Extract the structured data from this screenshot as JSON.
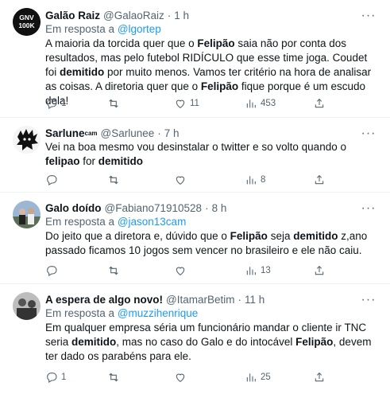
{
  "tweets": [
    {
      "name": "Galão Raiz",
      "handle": "@GalaoRaiz",
      "time": "1 h",
      "reply_prefix": "Em resposta a",
      "reply_to": "@lgortep",
      "body": [
        {
          "t": "A maioria da torcida quer que o "
        },
        {
          "t": "Felipão",
          "b": true
        },
        {
          "t": " saia não por conta dos resultados, mas pelo futebol RIDÍCULO que esse time joga. Coudet foi "
        },
        {
          "t": "demitido",
          "b": true
        },
        {
          "t": " por muito menos. Vamos ter critério na hora de analisar as coisas. A diretoria quer que o "
        },
        {
          "t": "Felipão",
          "b": true
        },
        {
          "t": " fique porque é um escudo dela!"
        }
      ],
      "replies": "1",
      "retweets": "",
      "likes": "11",
      "views": "453",
      "avatar": {
        "type": "gnv",
        "line1": "GNV",
        "line2": "100K"
      }
    },
    {
      "name": "Sarlune",
      "name_sup": "cam",
      "handle": "@Sarlunee",
      "time": "7 h",
      "body": [
        {
          "t": "Vei na boa mesmo vou desinstalar o twitter e so volto quando o "
        },
        {
          "t": "felipao",
          "b": true
        },
        {
          "t": " for "
        },
        {
          "t": "demitido",
          "b": true
        }
      ],
      "replies": "",
      "retweets": "",
      "likes": "",
      "views": "8",
      "avatar": {
        "type": "sketch"
      }
    },
    {
      "name": "Galo doído",
      "handle": "@Fabiano71910528",
      "time": "8 h",
      "reply_prefix": "Em resposta a",
      "reply_to": "@jason13cam",
      "body": [
        {
          "t": "Do jeito que a diretora e, dúvido que o "
        },
        {
          "t": "Felipão",
          "b": true
        },
        {
          "t": " seja "
        },
        {
          "t": "demitido",
          "b": true
        },
        {
          "t": " z,ano passado ficamos 10 jogos sem vencer no brasileiro e ele não caiu."
        }
      ],
      "replies": "",
      "retweets": "",
      "likes": "",
      "views": "13",
      "avatar": {
        "type": "photo"
      }
    },
    {
      "name": "A espera de algo novo!",
      "handle": "@ItamarBetim",
      "time": "11 h",
      "reply_prefix": "Em resposta a",
      "reply_to": "@muzzihenrique",
      "body": [
        {
          "t": "Em qualquer empresa séria um funcionário mandar o cliente ir TNC seria "
        },
        {
          "t": "demitido",
          "b": true
        },
        {
          "t": ", mas no caso do Galo e do intocável "
        },
        {
          "t": "Felipão",
          "b": true
        },
        {
          "t": ", devem ter dado os parabéns para ele."
        }
      ],
      "replies": "1",
      "retweets": "",
      "likes": "",
      "views": "25",
      "avatar": {
        "type": "bw"
      }
    }
  ],
  "colors": {
    "link": "#1d9bf0",
    "muted": "#536471",
    "text": "#0f1419",
    "divider": "#eff3f4"
  },
  "icons": {
    "reply": "reply-icon",
    "retweet": "retweet-icon",
    "like": "heart-icon",
    "views": "views-icon",
    "bookmark": "bookmark-icon",
    "more": "more-icon"
  }
}
